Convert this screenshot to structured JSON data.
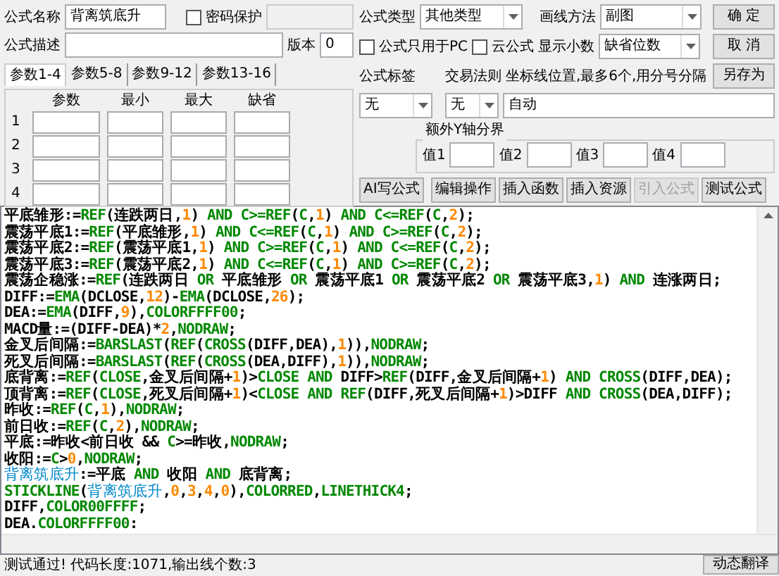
{
  "header": {
    "name_label": "公式名称",
    "name_value": "背离筑底升",
    "password": {
      "label": "密码保护",
      "checked": false
    },
    "desc_label": "公式描述",
    "version_label": "版本",
    "version_value": "0"
  },
  "settings": {
    "type_label": "公式类型",
    "type_value": "其他类型",
    "draw_label": "画线方法",
    "draw_value": "副图",
    "pc_only": {
      "label": "公式只用于PC",
      "checked": false
    },
    "cloud": {
      "label": "云公式",
      "checked": false
    },
    "decimals_label": "显示小数",
    "decimals_value": "缺省位数",
    "tag_label": "公式标签",
    "tag_value": "无",
    "rule_label": "交易法则",
    "rule_value": "无",
    "axis_label": "坐标线位置,最多6个,用分号分隔",
    "axis_value": "自动",
    "y_axis": {
      "title": "额外Y轴分界",
      "values": [
        "值1",
        "值2",
        "值3",
        "值4"
      ]
    }
  },
  "dialog_buttons": [
    "确 定",
    "取 消",
    "另存为"
  ],
  "tabs": [
    {
      "label": "参数1-4",
      "selected": true
    },
    {
      "label": "参数5-8",
      "selected": false
    },
    {
      "label": "参数9-12",
      "selected": false
    },
    {
      "label": "参数13-16",
      "selected": false
    }
  ],
  "params": {
    "columns": [
      "参数",
      "最小",
      "最大",
      "缺省"
    ],
    "rows": [
      "1",
      "2",
      "3",
      "4"
    ]
  },
  "toolbar": [
    {
      "label": "AI写公式",
      "disabled": false
    },
    {
      "label": "编辑操作",
      "disabled": false
    },
    {
      "label": "插入函数",
      "disabled": false
    },
    {
      "label": "插入资源",
      "disabled": false
    },
    {
      "label": "引入公式",
      "disabled": true
    },
    {
      "label": "测试公式",
      "disabled": false
    }
  ],
  "code_lines": [
    [
      {
        "kind": "txt",
        "text": "平底雏形:="
      },
      {
        "kind": "fn",
        "text": "REF"
      },
      {
        "kind": "txt",
        "text": "(连跌两日,"
      },
      {
        "kind": "num",
        "text": "1"
      },
      {
        "kind": "txt",
        "text": ") "
      },
      {
        "kind": "fn",
        "text": "AND C>=REF"
      },
      {
        "kind": "txt",
        "text": "("
      },
      {
        "kind": "fn",
        "text": "C"
      },
      {
        "kind": "txt",
        "text": ","
      },
      {
        "kind": "num",
        "text": "1"
      },
      {
        "kind": "txt",
        "text": ") "
      },
      {
        "kind": "fn",
        "text": "AND C<=REF"
      },
      {
        "kind": "txt",
        "text": "("
      },
      {
        "kind": "fn",
        "text": "C"
      },
      {
        "kind": "txt",
        "text": ","
      },
      {
        "kind": "num",
        "text": "2"
      },
      {
        "kind": "txt",
        "text": ");"
      }
    ],
    [
      {
        "kind": "txt",
        "text": "震荡平底1:="
      },
      {
        "kind": "fn",
        "text": "REF"
      },
      {
        "kind": "txt",
        "text": "(平底雏形,"
      },
      {
        "kind": "num",
        "text": "1"
      },
      {
        "kind": "txt",
        "text": ") "
      },
      {
        "kind": "fn",
        "text": "AND C<=REF"
      },
      {
        "kind": "txt",
        "text": "("
      },
      {
        "kind": "fn",
        "text": "C"
      },
      {
        "kind": "txt",
        "text": ","
      },
      {
        "kind": "num",
        "text": "1"
      },
      {
        "kind": "txt",
        "text": ") "
      },
      {
        "kind": "fn",
        "text": "AND C>=REF"
      },
      {
        "kind": "txt",
        "text": "("
      },
      {
        "kind": "fn",
        "text": "C"
      },
      {
        "kind": "txt",
        "text": ","
      },
      {
        "kind": "num",
        "text": "2"
      },
      {
        "kind": "txt",
        "text": ");"
      }
    ],
    [
      {
        "kind": "txt",
        "text": "震荡平底2:="
      },
      {
        "kind": "fn",
        "text": "REF"
      },
      {
        "kind": "txt",
        "text": "(震荡平底1,"
      },
      {
        "kind": "num",
        "text": "1"
      },
      {
        "kind": "txt",
        "text": ") "
      },
      {
        "kind": "fn",
        "text": "AND C>=REF"
      },
      {
        "kind": "txt",
        "text": "("
      },
      {
        "kind": "fn",
        "text": "C"
      },
      {
        "kind": "txt",
        "text": ","
      },
      {
        "kind": "num",
        "text": "1"
      },
      {
        "kind": "txt",
        "text": ") "
      },
      {
        "kind": "fn",
        "text": "AND C<=REF"
      },
      {
        "kind": "txt",
        "text": "("
      },
      {
        "kind": "fn",
        "text": "C"
      },
      {
        "kind": "txt",
        "text": ","
      },
      {
        "kind": "num",
        "text": "2"
      },
      {
        "kind": "txt",
        "text": ");"
      }
    ],
    [
      {
        "kind": "txt",
        "text": "震荡平底3:="
      },
      {
        "kind": "fn",
        "text": "REF"
      },
      {
        "kind": "txt",
        "text": "(震荡平底2,"
      },
      {
        "kind": "num",
        "text": "1"
      },
      {
        "kind": "txt",
        "text": ") "
      },
      {
        "kind": "fn",
        "text": "AND C<=REF"
      },
      {
        "kind": "txt",
        "text": "("
      },
      {
        "kind": "fn",
        "text": "C"
      },
      {
        "kind": "txt",
        "text": ","
      },
      {
        "kind": "num",
        "text": "1"
      },
      {
        "kind": "txt",
        "text": ") "
      },
      {
        "kind": "fn",
        "text": "AND C>=REF"
      },
      {
        "kind": "txt",
        "text": "("
      },
      {
        "kind": "fn",
        "text": "C"
      },
      {
        "kind": "txt",
        "text": ","
      },
      {
        "kind": "num",
        "text": "2"
      },
      {
        "kind": "txt",
        "text": ");"
      }
    ],
    [
      {
        "kind": "txt",
        "text": "震荡企稳涨:="
      },
      {
        "kind": "fn",
        "text": "REF"
      },
      {
        "kind": "txt",
        "text": "(连跌两日 "
      },
      {
        "kind": "fn",
        "text": "OR"
      },
      {
        "kind": "txt",
        "text": " 平底雏形 "
      },
      {
        "kind": "fn",
        "text": "OR"
      },
      {
        "kind": "txt",
        "text": " 震荡平底1 "
      },
      {
        "kind": "fn",
        "text": "OR"
      },
      {
        "kind": "txt",
        "text": " 震荡平底2 "
      },
      {
        "kind": "fn",
        "text": "OR"
      },
      {
        "kind": "txt",
        "text": " 震荡平底3,"
      },
      {
        "kind": "num",
        "text": "1"
      },
      {
        "kind": "txt",
        "text": ") "
      },
      {
        "kind": "fn",
        "text": "AND"
      },
      {
        "kind": "txt",
        "text": " 连涨两日;"
      }
    ],
    [
      {
        "kind": "txt",
        "text": "DIFF:="
      },
      {
        "kind": "fn",
        "text": "EMA"
      },
      {
        "kind": "txt",
        "text": "(DCLOSE,"
      },
      {
        "kind": "num",
        "text": "12"
      },
      {
        "kind": "txt",
        "text": ")-"
      },
      {
        "kind": "fn",
        "text": "EMA"
      },
      {
        "kind": "txt",
        "text": "(DCLOSE,"
      },
      {
        "kind": "num",
        "text": "26"
      },
      {
        "kind": "txt",
        "text": ");"
      }
    ],
    [
      {
        "kind": "txt",
        "text": "DEA:="
      },
      {
        "kind": "fn",
        "text": "EMA"
      },
      {
        "kind": "txt",
        "text": "(DIFF,"
      },
      {
        "kind": "num",
        "text": "9"
      },
      {
        "kind": "txt",
        "text": "),"
      },
      {
        "kind": "fn",
        "text": "COLORFFFF00"
      },
      {
        "kind": "txt",
        "text": ";"
      }
    ],
    [
      {
        "kind": "txt",
        "text": "MACD量:=(DIFF-DEA)*"
      },
      {
        "kind": "num",
        "text": "2"
      },
      {
        "kind": "txt",
        "text": ","
      },
      {
        "kind": "fn",
        "text": "NODRAW"
      },
      {
        "kind": "txt",
        "text": ";"
      }
    ],
    [
      {
        "kind": "txt",
        "text": "金叉后间隔:="
      },
      {
        "kind": "fn",
        "text": "BARSLAST"
      },
      {
        "kind": "txt",
        "text": "("
      },
      {
        "kind": "fn",
        "text": "REF"
      },
      {
        "kind": "txt",
        "text": "("
      },
      {
        "kind": "fn",
        "text": "CROSS"
      },
      {
        "kind": "txt",
        "text": "(DIFF,DEA),"
      },
      {
        "kind": "num",
        "text": "1"
      },
      {
        "kind": "txt",
        "text": ")),"
      },
      {
        "kind": "fn",
        "text": "NODRAW"
      },
      {
        "kind": "txt",
        "text": ";"
      }
    ],
    [
      {
        "kind": "txt",
        "text": "死叉后间隔:="
      },
      {
        "kind": "fn",
        "text": "BARSLAST"
      },
      {
        "kind": "txt",
        "text": "("
      },
      {
        "kind": "fn",
        "text": "REF"
      },
      {
        "kind": "txt",
        "text": "("
      },
      {
        "kind": "fn",
        "text": "CROSS"
      },
      {
        "kind": "txt",
        "text": "(DEA,DIFF),"
      },
      {
        "kind": "num",
        "text": "1"
      },
      {
        "kind": "txt",
        "text": ")),"
      },
      {
        "kind": "fn",
        "text": "NODRAW"
      },
      {
        "kind": "txt",
        "text": ";"
      }
    ],
    [
      {
        "kind": "txt",
        "text": "底背离:="
      },
      {
        "kind": "fn",
        "text": "REF"
      },
      {
        "kind": "txt",
        "text": "("
      },
      {
        "kind": "fn",
        "text": "CLOSE"
      },
      {
        "kind": "txt",
        "text": ",金叉后间隔+"
      },
      {
        "kind": "num",
        "text": "1"
      },
      {
        "kind": "txt",
        "text": ")>"
      },
      {
        "kind": "fn",
        "text": "CLOSE AND"
      },
      {
        "kind": "txt",
        "text": " DIFF>"
      },
      {
        "kind": "fn",
        "text": "REF"
      },
      {
        "kind": "txt",
        "text": "(DIFF,金叉后间隔+"
      },
      {
        "kind": "num",
        "text": "1"
      },
      {
        "kind": "txt",
        "text": ") "
      },
      {
        "kind": "fn",
        "text": "AND CROSS"
      },
      {
        "kind": "txt",
        "text": "(DIFF,DEA);"
      }
    ],
    [
      {
        "kind": "txt",
        "text": "顶背离:="
      },
      {
        "kind": "fn",
        "text": "REF"
      },
      {
        "kind": "txt",
        "text": "("
      },
      {
        "kind": "fn",
        "text": "CLOSE"
      },
      {
        "kind": "txt",
        "text": ",死叉后间隔+"
      },
      {
        "kind": "num",
        "text": "1"
      },
      {
        "kind": "txt",
        "text": ")<"
      },
      {
        "kind": "fn",
        "text": "CLOSE AND REF"
      },
      {
        "kind": "txt",
        "text": "(DIFF,死叉后间隔+"
      },
      {
        "kind": "num",
        "text": "1"
      },
      {
        "kind": "txt",
        "text": ")>DIFF "
      },
      {
        "kind": "fn",
        "text": "AND CROSS"
      },
      {
        "kind": "txt",
        "text": "(DEA,DIFF);"
      }
    ],
    [
      {
        "kind": "txt",
        "text": "昨收:="
      },
      {
        "kind": "fn",
        "text": "REF"
      },
      {
        "kind": "txt",
        "text": "("
      },
      {
        "kind": "fn",
        "text": "C"
      },
      {
        "kind": "txt",
        "text": ","
      },
      {
        "kind": "num",
        "text": "1"
      },
      {
        "kind": "txt",
        "text": "),"
      },
      {
        "kind": "fn",
        "text": "NODRAW"
      },
      {
        "kind": "txt",
        "text": ";"
      }
    ],
    [
      {
        "kind": "txt",
        "text": "前日收:="
      },
      {
        "kind": "fn",
        "text": "REF"
      },
      {
        "kind": "txt",
        "text": "("
      },
      {
        "kind": "fn",
        "text": "C"
      },
      {
        "kind": "txt",
        "text": ","
      },
      {
        "kind": "num",
        "text": "2"
      },
      {
        "kind": "txt",
        "text": "),"
      },
      {
        "kind": "fn",
        "text": "NODRAW"
      },
      {
        "kind": "txt",
        "text": ";"
      }
    ],
    [
      {
        "kind": "txt",
        "text": "平底:=昨收<前日收 && "
      },
      {
        "kind": "fn",
        "text": "C"
      },
      {
        "kind": "txt",
        "text": ">=昨收,"
      },
      {
        "kind": "fn",
        "text": "NODRAW"
      },
      {
        "kind": "txt",
        "text": ";"
      }
    ],
    [
      {
        "kind": "txt",
        "text": "收阳:="
      },
      {
        "kind": "fn",
        "text": "C"
      },
      {
        "kind": "txt",
        "text": ">"
      },
      {
        "kind": "num",
        "text": "0"
      },
      {
        "kind": "txt",
        "text": ","
      },
      {
        "kind": "fn",
        "text": "NODRAW"
      },
      {
        "kind": "txt",
        "text": ";"
      }
    ],
    [
      {
        "kind": "var",
        "text": "背离筑底升"
      },
      {
        "kind": "txt",
        "text": ":=平底 "
      },
      {
        "kind": "fn",
        "text": "AND"
      },
      {
        "kind": "txt",
        "text": " 收阳 "
      },
      {
        "kind": "fn",
        "text": "AND"
      },
      {
        "kind": "txt",
        "text": " 底背离;"
      }
    ],
    [
      {
        "kind": "fn",
        "text": "STICKLINE"
      },
      {
        "kind": "txt",
        "text": "("
      },
      {
        "kind": "var",
        "text": "背离筑底升"
      },
      {
        "kind": "txt",
        "text": ","
      },
      {
        "kind": "num",
        "text": "0"
      },
      {
        "kind": "txt",
        "text": ","
      },
      {
        "kind": "num",
        "text": "3"
      },
      {
        "kind": "txt",
        "text": ","
      },
      {
        "kind": "num",
        "text": "4"
      },
      {
        "kind": "txt",
        "text": ","
      },
      {
        "kind": "num",
        "text": "0"
      },
      {
        "kind": "txt",
        "text": "),"
      },
      {
        "kind": "fn",
        "text": "COLORRED"
      },
      {
        "kind": "txt",
        "text": ","
      },
      {
        "kind": "fn",
        "text": "LINETHICK4"
      },
      {
        "kind": "txt",
        "text": ";"
      }
    ],
    [
      {
        "kind": "txt",
        "text": "DIFF,"
      },
      {
        "kind": "fn",
        "text": "COLOR00FFFF"
      },
      {
        "kind": "txt",
        "text": ";"
      }
    ],
    [
      {
        "kind": "txt",
        "text": "DEA."
      },
      {
        "kind": "fn",
        "text": "COLORFFFF00"
      },
      {
        "kind": "txt",
        "text": ":"
      }
    ]
  ],
  "status_bar": {
    "text": "测试通过! 代码长度:1071,输出线个数:3",
    "button": "动态翻译"
  }
}
